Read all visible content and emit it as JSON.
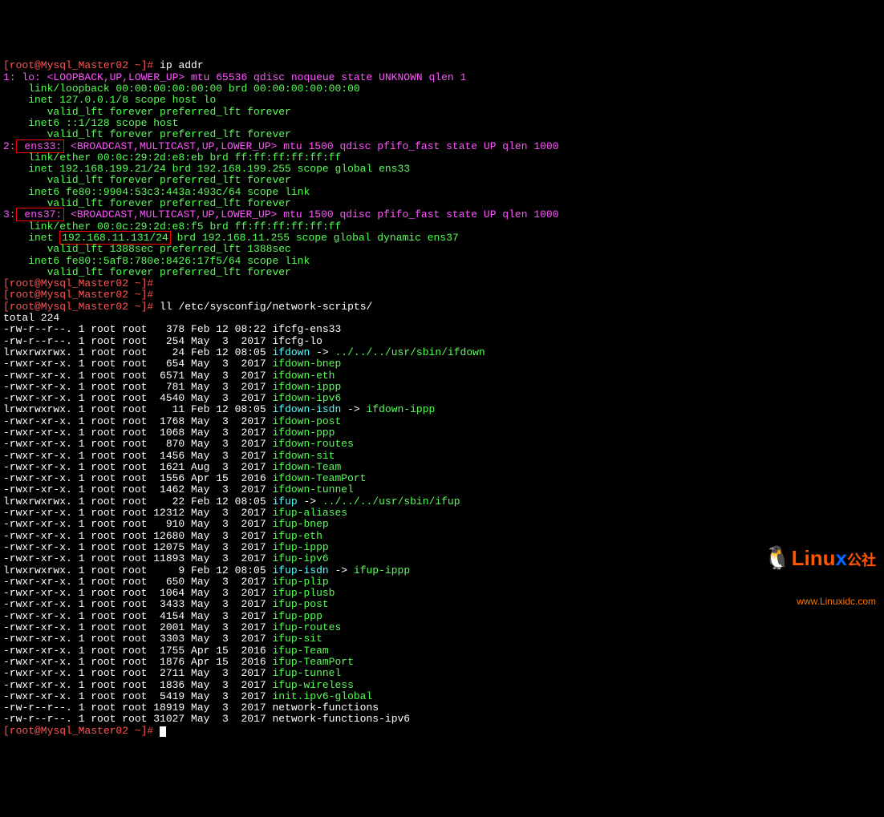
{
  "prompt": "[root@Mysql_Master02 ~]#",
  "cmd_ip": "ip addr",
  "cmd_ll": "ll /etc/sysconfig/network-scripts/",
  "lo": {
    "header": "1: lo: <LOOPBACK,UP,LOWER_UP> mtu 65536 qdisc noqueue state UNKNOWN qlen 1",
    "link": "    link/loopback 00:00:00:00:00:00 brd 00:00:00:00:00:00",
    "inet": "    inet 127.0.0.1/8 scope host lo",
    "vl1": "       valid_lft forever preferred_lft forever",
    "inet6": "    inet6 ::1/128 scope host",
    "vl2": "       valid_lft forever preferred_lft forever"
  },
  "ens33": {
    "num": "2:",
    "name": " ens33:",
    "header_rest": " <BROADCAST,MULTICAST,UP,LOWER_UP> mtu 1500 qdisc pfifo_fast state UP qlen 1000",
    "link": "    link/ether 00:0c:29:2d:e8:eb brd ff:ff:ff:ff:ff:ff",
    "inet": "    inet 192.168.199.21/24 brd 192.168.199.255 scope global ens33",
    "vl1": "       valid_lft forever preferred_lft forever",
    "inet6": "    inet6 fe80::9904:53c3:443a:493c/64 scope link",
    "vl2": "       valid_lft forever preferred_lft forever"
  },
  "ens37": {
    "num": "3:",
    "name": " ens37:",
    "header_rest": " <BROADCAST,MULTICAST,UP,LOWER_UP> mtu 1500 qdisc pfifo_fast state UP qlen 1000",
    "link": "    link/ether 00:0c:29:2d:e8:f5 brd ff:ff:ff:ff:ff:ff",
    "inet_pre": "    inet ",
    "inet_box": "192.168.11.131/24",
    "inet_post": " brd 192.168.11.255 scope global dynamic ens37",
    "vl1": "       valid_lft 1388sec preferred_lft 1388sec",
    "inet6": "    inet6 fe80::5af8:780e:8426:17f5/64 scope link",
    "vl2": "       valid_lft forever preferred_lft forever"
  },
  "total": "total 224",
  "ls": [
    {
      "perm": "-rw-r--r--.",
      "n": "1",
      "u": "root",
      "g": "root",
      "sz": "  378",
      "date": "Feb 12 08:22",
      "name": "ifcfg-ens33",
      "color": "white"
    },
    {
      "perm": "-rw-r--r--.",
      "n": "1",
      "u": "root",
      "g": "root",
      "sz": "  254",
      "date": "May  3  2017",
      "name": "ifcfg-lo",
      "color": "white"
    },
    {
      "perm": "lrwxrwxrwx.",
      "n": "1",
      "u": "root",
      "g": "root",
      "sz": "   24",
      "date": "Feb 12 08:05",
      "name": "ifdown",
      "color": "cyan",
      "arrow": " -> ",
      "target": "../../../usr/sbin/ifdown",
      "tcolor": "green"
    },
    {
      "perm": "-rwxr-xr-x.",
      "n": "1",
      "u": "root",
      "g": "root",
      "sz": "  654",
      "date": "May  3  2017",
      "name": "ifdown-bnep",
      "color": "green"
    },
    {
      "perm": "-rwxr-xr-x.",
      "n": "1",
      "u": "root",
      "g": "root",
      "sz": " 6571",
      "date": "May  3  2017",
      "name": "ifdown-eth",
      "color": "green"
    },
    {
      "perm": "-rwxr-xr-x.",
      "n": "1",
      "u": "root",
      "g": "root",
      "sz": "  781",
      "date": "May  3  2017",
      "name": "ifdown-ippp",
      "color": "green"
    },
    {
      "perm": "-rwxr-xr-x.",
      "n": "1",
      "u": "root",
      "g": "root",
      "sz": " 4540",
      "date": "May  3  2017",
      "name": "ifdown-ipv6",
      "color": "green"
    },
    {
      "perm": "lrwxrwxrwx.",
      "n": "1",
      "u": "root",
      "g": "root",
      "sz": "   11",
      "date": "Feb 12 08:05",
      "name": "ifdown-isdn",
      "color": "cyan",
      "arrow": " -> ",
      "target": "ifdown-ippp",
      "tcolor": "green"
    },
    {
      "perm": "-rwxr-xr-x.",
      "n": "1",
      "u": "root",
      "g": "root",
      "sz": " 1768",
      "date": "May  3  2017",
      "name": "ifdown-post",
      "color": "green"
    },
    {
      "perm": "-rwxr-xr-x.",
      "n": "1",
      "u": "root",
      "g": "root",
      "sz": " 1068",
      "date": "May  3  2017",
      "name": "ifdown-ppp",
      "color": "green"
    },
    {
      "perm": "-rwxr-xr-x.",
      "n": "1",
      "u": "root",
      "g": "root",
      "sz": "  870",
      "date": "May  3  2017",
      "name": "ifdown-routes",
      "color": "green"
    },
    {
      "perm": "-rwxr-xr-x.",
      "n": "1",
      "u": "root",
      "g": "root",
      "sz": " 1456",
      "date": "May  3  2017",
      "name": "ifdown-sit",
      "color": "green"
    },
    {
      "perm": "-rwxr-xr-x.",
      "n": "1",
      "u": "root",
      "g": "root",
      "sz": " 1621",
      "date": "Aug  3  2017",
      "name": "ifdown-Team",
      "color": "green"
    },
    {
      "perm": "-rwxr-xr-x.",
      "n": "1",
      "u": "root",
      "g": "root",
      "sz": " 1556",
      "date": "Apr 15  2016",
      "name": "ifdown-TeamPort",
      "color": "green"
    },
    {
      "perm": "-rwxr-xr-x.",
      "n": "1",
      "u": "root",
      "g": "root",
      "sz": " 1462",
      "date": "May  3  2017",
      "name": "ifdown-tunnel",
      "color": "green"
    },
    {
      "perm": "lrwxrwxrwx.",
      "n": "1",
      "u": "root",
      "g": "root",
      "sz": "   22",
      "date": "Feb 12 08:05",
      "name": "ifup",
      "color": "cyan",
      "arrow": " -> ",
      "target": "../../../usr/sbin/ifup",
      "tcolor": "green"
    },
    {
      "perm": "-rwxr-xr-x.",
      "n": "1",
      "u": "root",
      "g": "root",
      "sz": "12312",
      "date": "May  3  2017",
      "name": "ifup-aliases",
      "color": "green"
    },
    {
      "perm": "-rwxr-xr-x.",
      "n": "1",
      "u": "root",
      "g": "root",
      "sz": "  910",
      "date": "May  3  2017",
      "name": "ifup-bnep",
      "color": "green"
    },
    {
      "perm": "-rwxr-xr-x.",
      "n": "1",
      "u": "root",
      "g": "root",
      "sz": "12680",
      "date": "May  3  2017",
      "name": "ifup-eth",
      "color": "green"
    },
    {
      "perm": "-rwxr-xr-x.",
      "n": "1",
      "u": "root",
      "g": "root",
      "sz": "12075",
      "date": "May  3  2017",
      "name": "ifup-ippp",
      "color": "green"
    },
    {
      "perm": "-rwxr-xr-x.",
      "n": "1",
      "u": "root",
      "g": "root",
      "sz": "11893",
      "date": "May  3  2017",
      "name": "ifup-ipv6",
      "color": "green"
    },
    {
      "perm": "lrwxrwxrwx.",
      "n": "1",
      "u": "root",
      "g": "root",
      "sz": "    9",
      "date": "Feb 12 08:05",
      "name": "ifup-isdn",
      "color": "cyan",
      "arrow": " -> ",
      "target": "ifup-ippp",
      "tcolor": "green"
    },
    {
      "perm": "-rwxr-xr-x.",
      "n": "1",
      "u": "root",
      "g": "root",
      "sz": "  650",
      "date": "May  3  2017",
      "name": "ifup-plip",
      "color": "green"
    },
    {
      "perm": "-rwxr-xr-x.",
      "n": "1",
      "u": "root",
      "g": "root",
      "sz": " 1064",
      "date": "May  3  2017",
      "name": "ifup-plusb",
      "color": "green"
    },
    {
      "perm": "-rwxr-xr-x.",
      "n": "1",
      "u": "root",
      "g": "root",
      "sz": " 3433",
      "date": "May  3  2017",
      "name": "ifup-post",
      "color": "green"
    },
    {
      "perm": "-rwxr-xr-x.",
      "n": "1",
      "u": "root",
      "g": "root",
      "sz": " 4154",
      "date": "May  3  2017",
      "name": "ifup-ppp",
      "color": "green"
    },
    {
      "perm": "-rwxr-xr-x.",
      "n": "1",
      "u": "root",
      "g": "root",
      "sz": " 2001",
      "date": "May  3  2017",
      "name": "ifup-routes",
      "color": "green"
    },
    {
      "perm": "-rwxr-xr-x.",
      "n": "1",
      "u": "root",
      "g": "root",
      "sz": " 3303",
      "date": "May  3  2017",
      "name": "ifup-sit",
      "color": "green"
    },
    {
      "perm": "-rwxr-xr-x.",
      "n": "1",
      "u": "root",
      "g": "root",
      "sz": " 1755",
      "date": "Apr 15  2016",
      "name": "ifup-Team",
      "color": "green"
    },
    {
      "perm": "-rwxr-xr-x.",
      "n": "1",
      "u": "root",
      "g": "root",
      "sz": " 1876",
      "date": "Apr 15  2016",
      "name": "ifup-TeamPort",
      "color": "green"
    },
    {
      "perm": "-rwxr-xr-x.",
      "n": "1",
      "u": "root",
      "g": "root",
      "sz": " 2711",
      "date": "May  3  2017",
      "name": "ifup-tunnel",
      "color": "green"
    },
    {
      "perm": "-rwxr-xr-x.",
      "n": "1",
      "u": "root",
      "g": "root",
      "sz": " 1836",
      "date": "May  3  2017",
      "name": "ifup-wireless",
      "color": "green"
    },
    {
      "perm": "-rwxr-xr-x.",
      "n": "1",
      "u": "root",
      "g": "root",
      "sz": " 5419",
      "date": "May  3  2017",
      "name": "init.ipv6-global",
      "color": "green"
    },
    {
      "perm": "-rw-r--r--.",
      "n": "1",
      "u": "root",
      "g": "root",
      "sz": "18919",
      "date": "May  3  2017",
      "name": "network-functions",
      "color": "white"
    },
    {
      "perm": "-rw-r--r--.",
      "n": "1",
      "u": "root",
      "g": "root",
      "sz": "31027",
      "date": "May  3  2017",
      "name": "network-functions-ipv6",
      "color": "white"
    }
  ],
  "logo": {
    "main1": "Linu",
    "main2": "x",
    "sub": "公社",
    "url": "www.Linuxidc.com"
  }
}
